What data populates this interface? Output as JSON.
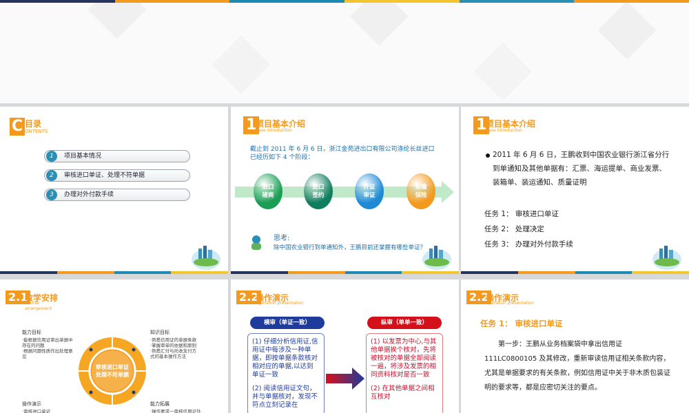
{
  "colors": {
    "orange": "#f39a1e",
    "teal": "#2a8fb5",
    "navy": "#1f3b73",
    "red": "#c8102e"
  },
  "top_stripe": [
    "#26345c",
    "#f39a1e",
    "#1e8ab3",
    "#f5c530",
    "#2a8fb5",
    "#f39a1e"
  ],
  "slide_toc": {
    "letter": "C",
    "title": "目录",
    "subtitle": "ONTENTS",
    "items": [
      {
        "num": "1",
        "label": "项目基本情况"
      },
      {
        "num": "2",
        "label": "审核进口单证、处理不符单据"
      },
      {
        "num": "3",
        "label": "办理对外付款手续"
      }
    ]
  },
  "slide_intro": {
    "num": "1",
    "title": "项目基本介绍",
    "subtitle": "Case introduction",
    "text": "截止到 2011 年 6 月 6 日，浙江金苑进出口有限公司涤纶长丝进口已经历如下 4 个阶段：",
    "phases": [
      {
        "label": "进口\n磋商",
        "color": "#1a9e55"
      },
      {
        "label": "进口\n签约",
        "color": "#0f7d5e"
      },
      {
        "label": "开证\n审证",
        "color": "#1e8ad6"
      },
      {
        "label": "运输\n保险",
        "color": "#f39a1e"
      }
    ],
    "think_title": "思考:",
    "think_text": "除中国农业银行到单通知外，王鹏目前还掌握有哪些单证？"
  },
  "slide_intro2": {
    "num": "1",
    "title": "项目基本介绍",
    "subtitle": "Case introduction",
    "bullet_line1": "2011 年 6 月 6 日，王鹏收到中国农业银行浙江省分行",
    "bullet_line2": "到单通知及其他单据有：汇票、海运提单、商业发票、",
    "bullet_line3": "装箱单、装运通知、质量证明",
    "tasks": [
      "任务 1：  审核进口单证",
      "任务 2：  处理决定",
      "任务 3：  办理对外付款手续"
    ]
  },
  "slide_teaching": {
    "num": "2.1",
    "title": "教学安排",
    "subtitle1": "Course",
    "subtitle2": "arrangement",
    "center_line1": "审核进口单证",
    "center_line2": "处理不符单据",
    "q1_title": "能力目标",
    "q1_lines": [
      "·能根据信用证审出单据中",
      "存在的问题",
      "·根据问题性质作出处理意",
      "见"
    ],
    "q2_title": "知识目标",
    "q2_lines": [
      "·熟悉信用证的单据条款",
      "·掌握审单的依据和原则",
      "·熟悉汇付与托收支付方",
      "式的基本操作方法"
    ],
    "q3_title": "操作演示",
    "q3_lines": [
      "·审核进口单证"
    ],
    "q4_title": "能力拓展",
    "q4_lines": [
      "·操作要求一审核信用证外"
    ]
  },
  "slide_demo1": {
    "num": "2.2",
    "title": "操作演示",
    "subtitle": "Operation presentation",
    "left_tag": "横审（单证一致）",
    "right_tag": "纵审（单单一致）",
    "left_p1": "(1)  仔细分析信用证,信用证中每涉及一种单据，即按单据条款核对相对应的单据,以达到单证一致",
    "left_p2": "(2)  阅读信用证文句，并与单据核对，发现不符点立刻记录在",
    "right_p1": "(1)  以发票为中心,与其他单据挨个核对，先将被核对的单据全部阅读一遍，将涉及发票的相同资料核对是否一致",
    "right_p2": "(2)  在其他单据之间相互核对"
  },
  "slide_demo2": {
    "num": "2.2",
    "title": "操作演示",
    "subtitle": "Operation presentation",
    "task_title": "任务 1：  审核进口单证",
    "body": "第一步：王鹏从业务档案袋中拿出信用证 111LC0800105 及其修改，重新审读信用证相关条款内容，尤其是单据要求的有关条款，例如信用证中关于非木质包装证明的要求等，都是应密切关注的要点。"
  }
}
